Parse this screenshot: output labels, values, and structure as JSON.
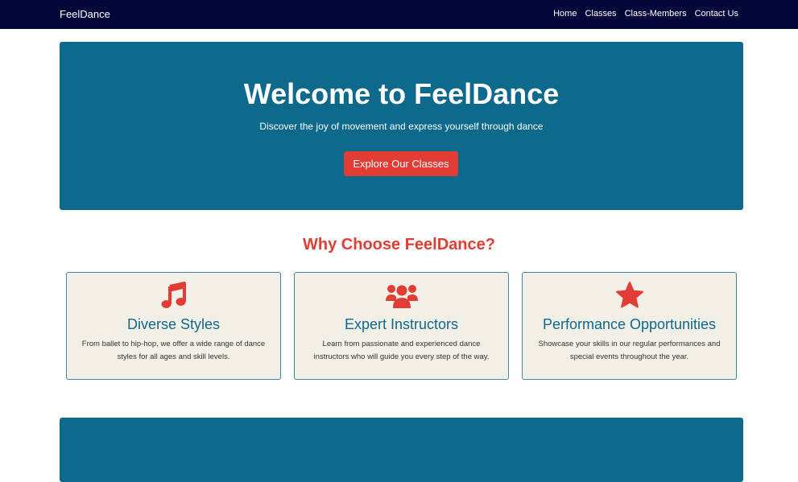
{
  "navbar": {
    "brand": "FeelDance",
    "links": [
      "Home",
      "Classes",
      "Class-Members",
      "Contact Us"
    ]
  },
  "hero": {
    "title": "Welcome to FeelDance",
    "subtitle": "Discover the joy of movement and express yourself through dance",
    "cta_label": "Explore Our Classes"
  },
  "features": {
    "title": "Why Choose FeelDance?",
    "cards": [
      {
        "icon": "music-note-icon",
        "title": "Diverse Styles",
        "text": "From ballet to hip-hop, we offer a wide range of dance styles for all ages and skill levels."
      },
      {
        "icon": "users-icon",
        "title": "Expert Instructors",
        "text": "Learn from passionate and experienced dance instructors who will guide you every step of the way."
      },
      {
        "icon": "star-icon",
        "title": "Performance Opportunities",
        "text": "Showcase your skills in our regular performances and special events throughout the year."
      }
    ]
  },
  "colors": {
    "navbar": "#04063a",
    "primary": "#0d6a8c",
    "accent": "#e23d35",
    "card_bg": "#f2efe7"
  }
}
